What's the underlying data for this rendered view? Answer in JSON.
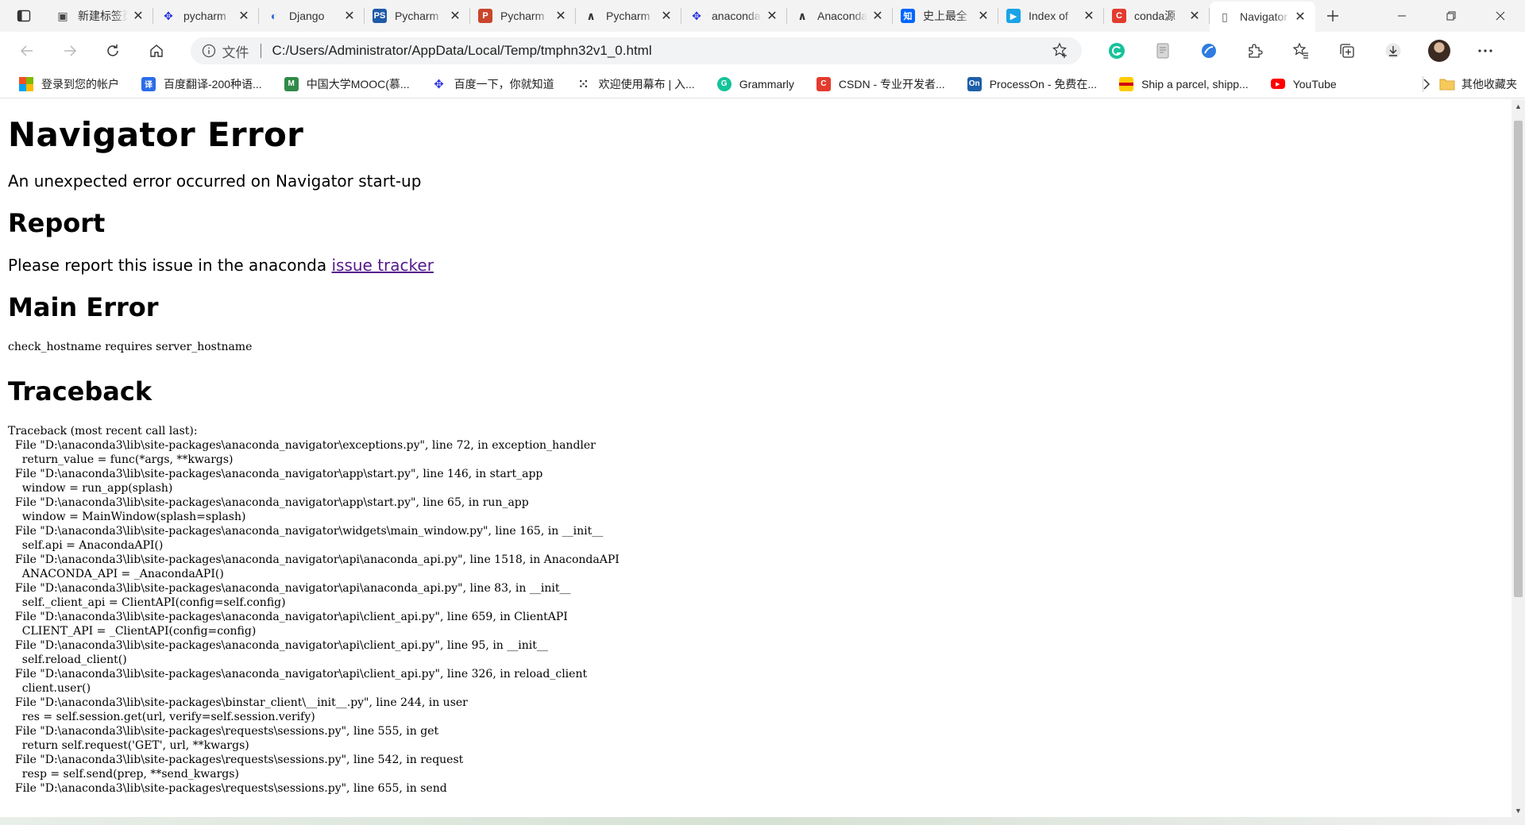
{
  "tabs": [
    {
      "title": "新建标签页",
      "icon": "new-tab-page-icon",
      "color": "#444444"
    },
    {
      "title": "pycharm",
      "icon": "baidu-paw-icon",
      "color": "#2932e1"
    },
    {
      "title": "Django",
      "icon": "django-circle-icon",
      "color": "#2c6bd8"
    },
    {
      "title": "Pycharm",
      "icon": "ps-logo-icon",
      "color": "#1f5aa8"
    },
    {
      "title": "Pycharm",
      "icon": "jetbrains-icon",
      "color": "#c8462c"
    },
    {
      "title": "Pycharm",
      "icon": "wolf-icon",
      "color": "#333333"
    },
    {
      "title": "anaconda",
      "icon": "baidu-paw-icon",
      "color": "#2932e1"
    },
    {
      "title": "Anaconda",
      "icon": "wolf-icon",
      "color": "#333333"
    },
    {
      "title": "史上最全",
      "icon": "zhihu-icon",
      "color": "#0066ff"
    },
    {
      "title": "Index of",
      "icon": "tsinghua-icon",
      "color": "#1aa3e8"
    },
    {
      "title": "conda源",
      "icon": "csdn-icon",
      "color": "#e33b2e"
    },
    {
      "title": "Navigator",
      "icon": "document-icon",
      "color": "#555555",
      "active": true
    }
  ],
  "address": {
    "file_label": "文件",
    "url": "C:/Users/Administrator/AppData/Local/Temp/tmphn32v1_0.html"
  },
  "bookmarks": [
    {
      "label": "登录到您的帐户",
      "icon": "microsoft-icon",
      "color": "#f25022"
    },
    {
      "label": "百度翻译-200种语...",
      "icon": "baidu-translate-icon",
      "color": "#2b6de8"
    },
    {
      "label": "中国大学MOOC(慕...",
      "icon": "mooc-icon",
      "color": "#2f8a4a"
    },
    {
      "label": "百度一下，你就知道",
      "icon": "baidu-paw-icon",
      "color": "#2932e1"
    },
    {
      "label": "欢迎使用幕布 | 入...",
      "icon": "mubu-icon",
      "color": "#333333"
    },
    {
      "label": "Grammarly",
      "icon": "grammarly-icon",
      "color": "#15c39a"
    },
    {
      "label": "CSDN - 专业开发者...",
      "icon": "csdn-icon",
      "color": "#e33b2e"
    },
    {
      "label": "ProcessOn - 免费在...",
      "icon": "processon-icon",
      "color": "#1e5fa8"
    },
    {
      "label": "Ship a parcel, shipp...",
      "icon": "dhl-icon",
      "color": "#ffcc00"
    },
    {
      "label": "YouTube",
      "icon": "youtube-icon",
      "color": "#ff0000"
    }
  ],
  "bookmarks_other": "其他收藏夹",
  "page": {
    "title": "Navigator Error",
    "subtitle": "An unexpected error occurred on Navigator start-up",
    "report_heading": "Report",
    "report_text": "Please report this issue in the anaconda ",
    "report_link": "issue tracker",
    "main_error_heading": "Main Error",
    "main_error": "check_hostname requires server_hostname",
    "traceback_heading": "Traceback",
    "traceback": [
      "Traceback (most recent call last):",
      "  File \"D:\\anaconda3\\lib\\site-packages\\anaconda_navigator\\exceptions.py\", line 72, in exception_handler",
      "    return_value = func(*args, **kwargs)",
      "  File \"D:\\anaconda3\\lib\\site-packages\\anaconda_navigator\\app\\start.py\", line 146, in start_app",
      "    window = run_app(splash)",
      "  File \"D:\\anaconda3\\lib\\site-packages\\anaconda_navigator\\app\\start.py\", line 65, in run_app",
      "    window = MainWindow(splash=splash)",
      "  File \"D:\\anaconda3\\lib\\site-packages\\anaconda_navigator\\widgets\\main_window.py\", line 165, in __init__",
      "    self.api = AnacondaAPI()",
      "  File \"D:\\anaconda3\\lib\\site-packages\\anaconda_navigator\\api\\anaconda_api.py\", line 1518, in AnacondaAPI",
      "    ANACONDA_API = _AnacondaAPI()",
      "  File \"D:\\anaconda3\\lib\\site-packages\\anaconda_navigator\\api\\anaconda_api.py\", line 83, in __init__",
      "    self._client_api = ClientAPI(config=self.config)",
      "  File \"D:\\anaconda3\\lib\\site-packages\\anaconda_navigator\\api\\client_api.py\", line 659, in ClientAPI",
      "    CLIENT_API = _ClientAPI(config=config)",
      "  File \"D:\\anaconda3\\lib\\site-packages\\anaconda_navigator\\api\\client_api.py\", line 95, in __init__",
      "    self.reload_client()",
      "  File \"D:\\anaconda3\\lib\\site-packages\\anaconda_navigator\\api\\client_api.py\", line 326, in reload_client",
      "    client.user()",
      "  File \"D:\\anaconda3\\lib\\site-packages\\binstar_client\\__init__.py\", line 244, in user",
      "    res = self.session.get(url, verify=self.session.verify)",
      "  File \"D:\\anaconda3\\lib\\site-packages\\requests\\sessions.py\", line 555, in get",
      "    return self.request('GET', url, **kwargs)",
      "  File \"D:\\anaconda3\\lib\\site-packages\\requests\\sessions.py\", line 542, in request",
      "    resp = self.send(prep, **send_kwargs)",
      "  File \"D:\\anaconda3\\lib\\site-packages\\requests\\sessions.py\", line 655, in send"
    ]
  },
  "colors": {
    "tabstrip_bg": "#f3f3f3",
    "link_visited": "#551a8b",
    "omnibox_bg": "#f1f3f4"
  }
}
